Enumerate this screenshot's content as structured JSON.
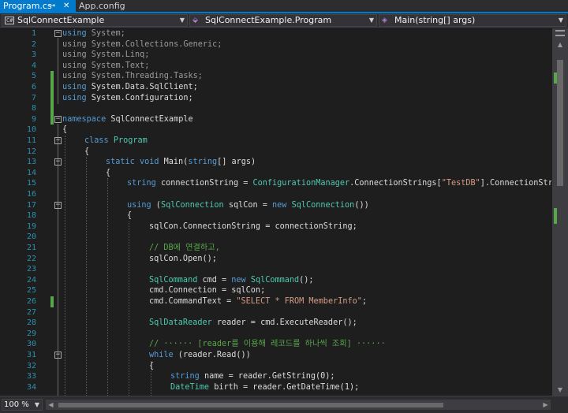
{
  "tabs": [
    {
      "label": "Program.cs",
      "active": true,
      "pin_icon": "pin-icon",
      "close_icon": "close-icon"
    },
    {
      "label": "App.config",
      "active": false
    }
  ],
  "navbar": {
    "project": {
      "icon": "csharp-project-icon",
      "badge": "C#",
      "label": "SqlConnectExample"
    },
    "type": {
      "icon": "class-icon",
      "label": "SqlConnectExample.Program"
    },
    "member": {
      "icon": "method-icon",
      "label": "Main(string[] args)"
    }
  },
  "line_numbers": [
    "1",
    "2",
    "3",
    "4",
    "5",
    "6",
    "7",
    "8",
    "9",
    "10",
    "11",
    "12",
    "13",
    "14",
    "15",
    "16",
    "17",
    "18",
    "19",
    "20",
    "21",
    "22",
    "23",
    "24",
    "25",
    "26",
    "27",
    "28",
    "29",
    "30",
    "31",
    "32",
    "33",
    "34"
  ],
  "code": {
    "l1": {
      "kw": "using",
      "rest": " System;"
    },
    "l2": {
      "kw": "using",
      "rest": " System.Collections.Generic;"
    },
    "l3": {
      "kw": "using",
      "rest": " System.Linq;"
    },
    "l4": {
      "kw": "using",
      "rest": " System.Text;"
    },
    "l5": {
      "kw": "using",
      "rest": " System.Threading.Tasks;"
    },
    "l6": {
      "kw": "using",
      "rest": " System.Data.SqlClient;"
    },
    "l7": {
      "kw": "using",
      "rest": " System.Configuration;"
    },
    "l9": {
      "kw": "namespace",
      "rest": " SqlConnectExample"
    },
    "l10": "{",
    "l11": {
      "kw": "class",
      "type": "Program"
    },
    "l12": "{",
    "l13": {
      "kw1": "static",
      "kw2": "void",
      "name": " Main(",
      "kw3": "string",
      "rest": "[] args)"
    },
    "l14": "{",
    "l15": {
      "kw": "string",
      "a": " connectionString = ",
      "type": "ConfigurationManager",
      "b": ".ConnectionStrings[",
      "str": "\"TestDB\"",
      "c": "].ConnectionStrin"
    },
    "l17": {
      "kw": "using",
      "a": " (",
      "type": "SqlConnection",
      "b": " sqlCon = ",
      "kw2": "new",
      "type2": " SqlConnection",
      "c": "())"
    },
    "l18": "{",
    "l19": "sqlCon.ConnectionString = connectionString;",
    "l21": "// DB에 연결하고,",
    "l22": "sqlCon.Open();",
    "l24": {
      "type": "SqlCommand",
      "a": " cmd = ",
      "kw": "new",
      "type2": " SqlCommand",
      "b": "();"
    },
    "l25": "cmd.Connection = sqlCon;",
    "l26": {
      "a": "cmd.CommandText = ",
      "str": "\"SELECT * FROM MemberInfo\"",
      "b": ";"
    },
    "l28": {
      "type": "SqlDataReader",
      "a": " reader = cmd.ExecuteReader();"
    },
    "l30": "// ······ [reader를 이용해 레코드를 하나씩 조회] ······",
    "l31": {
      "kw": "while",
      "a": " (reader.Read())"
    },
    "l32": "{",
    "l33": {
      "kw": "string",
      "a": " name = reader.GetString(0);"
    },
    "l34": {
      "type": "DateTime",
      "a": " birth = reader.GetDateTime(1);"
    }
  },
  "zoom": {
    "value": "100 %"
  },
  "colors": {
    "accent": "#007acc",
    "keyword": "#569cd6",
    "type": "#4ec9b0",
    "string": "#d69d85",
    "comment": "#57a64a",
    "line_number": "#2b91af"
  }
}
